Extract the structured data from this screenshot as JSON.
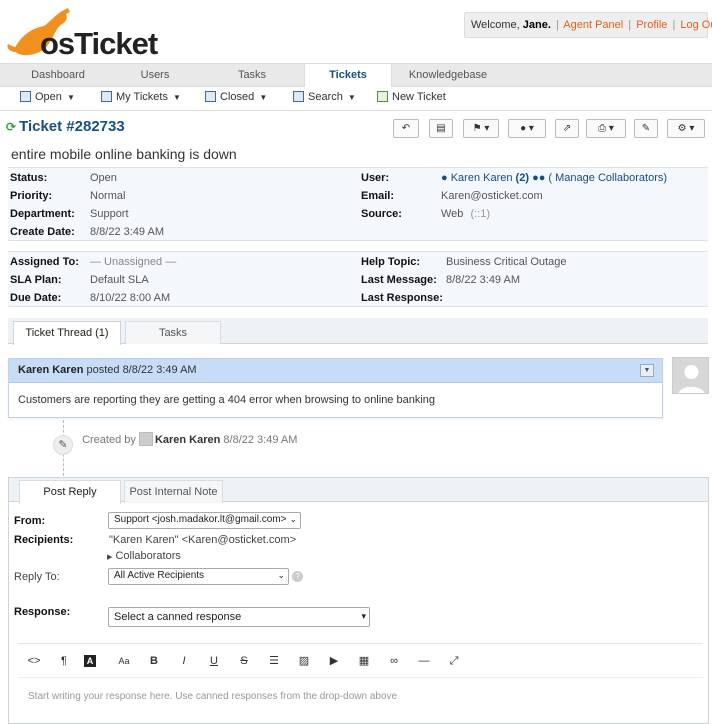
{
  "header": {
    "logo_text": "osTicket",
    "welcome_prefix": "Welcome,",
    "user_name": "Jane.",
    "links": [
      "Agent Panel",
      "Profile",
      "Log Out"
    ]
  },
  "nav": {
    "tabs": [
      "Dashboard",
      "Users",
      "Tasks",
      "Tickets",
      "Knowledgebase"
    ],
    "active": "Tickets"
  },
  "subnav": {
    "items": [
      "Open",
      "My Tickets",
      "Closed",
      "Search",
      "New Ticket"
    ]
  },
  "ticket": {
    "title": "Ticket #282733",
    "subject": "entire mobile online banking is down",
    "status_label": "Status:",
    "status": "Open",
    "priority_label": "Priority:",
    "priority": "Normal",
    "department_label": "Department:",
    "department": "Support",
    "create_date_label": "Create Date:",
    "create_date": "8/8/22 3:49 AM",
    "user_label": "User:",
    "user": "Karen Karen",
    "user_count": "(2)",
    "manage_collaborators": "( Manage Collaborators)",
    "email_label": "Email:",
    "email": "Karen@osticket.com",
    "source_label": "Source:",
    "source": "Web",
    "source_ip": "(::1)",
    "assigned_label": "Assigned To:",
    "assigned": "— Unassigned —",
    "sla_label": "SLA Plan:",
    "sla": "Default SLA",
    "due_label": "Due Date:",
    "due": "8/10/22 8:00 AM",
    "help_topic_label": "Help Topic:",
    "help_topic": "Business Critical Outage",
    "last_message_label": "Last Message:",
    "last_message": "8/8/22 3:49 AM",
    "last_response_label": "Last Response:",
    "last_response": ""
  },
  "thread_tabs": [
    "Ticket Thread (1)",
    "Tasks"
  ],
  "entry": {
    "author": "Karen Karen",
    "posted": "posted 8/8/22 3:49 AM",
    "body": "Customers are reporting they are getting a 404 error when browsing to online banking"
  },
  "event": {
    "created_by": "Created by",
    "author": "Karen Karen",
    "date": "8/8/22 3:49 AM"
  },
  "reply": {
    "tabs": [
      "Post Reply",
      "Post Internal Note"
    ],
    "from_label": "From:",
    "from_value": "Support <josh.madakor.lt@gmail.com>",
    "recipients_label": "Recipients:",
    "recipients_value": "\"Karen Karen\" <Karen@osticket.com>",
    "collaborators": "Collaborators",
    "reply_to_label": "Reply To:",
    "reply_to_value": "All Active Recipients",
    "response_label": "Response:",
    "canned_placeholder": "Select a canned response",
    "editor_placeholder": "Start writing your response here. Use canned responses from the drop-down above"
  },
  "editor_tools": [
    "<>",
    "¶",
    "A",
    "Aa",
    "B",
    "I",
    "U",
    "S",
    "list-icon",
    "image-icon",
    "video-icon",
    "table-icon",
    "link-icon",
    "hr-icon",
    "fullscreen-icon"
  ],
  "colors": {
    "brand_orange": "#e35d1b",
    "link_blue": "#184e81",
    "entry_header": "#c7dcf7"
  }
}
